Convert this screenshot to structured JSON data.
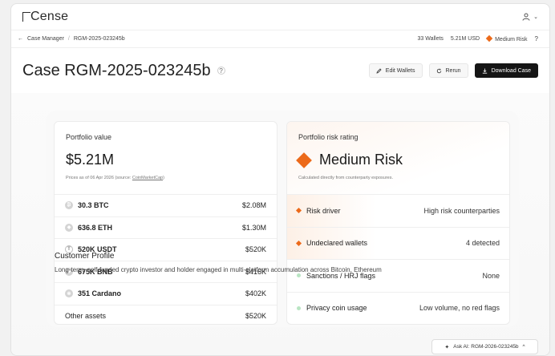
{
  "app": {
    "logo_text": "Cense"
  },
  "breadcrumb": {
    "back": "←",
    "root": "Case Manager",
    "sep": "/",
    "current": "RGM-2025-023245b"
  },
  "stats": {
    "wallets": "33 Wallets",
    "usd": "5.21M USD",
    "risk": "Medium Risk",
    "help": "?"
  },
  "page": {
    "title": "Case RGM-2025-023245b",
    "help": "?"
  },
  "actions": {
    "edit": "Edit Wallets",
    "rerun": "Rerun",
    "download": "Download Case"
  },
  "portfolio": {
    "label": "Portfolio value",
    "value": "$5.21M",
    "note_prefix": "Prices as of 06 Apr 2026 (source: ",
    "note_link": "CoinMarketCap",
    "note_suffix": ")",
    "rows": [
      {
        "name": "30.3 BTC",
        "amount": "$2.08M",
        "icon": "bitcoin-icon"
      },
      {
        "name": "636.8 ETH",
        "amount": "$1.30M",
        "icon": "ethereum-icon"
      },
      {
        "name": "520K USDT",
        "amount": "$520K",
        "icon": "tether-icon"
      },
      {
        "name": "675K BNB",
        "amount": "$416K",
        "icon": "bnb-icon"
      },
      {
        "name": "351 Cardano",
        "amount": "$402K",
        "icon": "cardano-icon"
      }
    ],
    "other": {
      "name": "Other assets",
      "amount": "$520K"
    }
  },
  "risk": {
    "label": "Portfolio risk rating",
    "value": "Medium Risk",
    "note": "Calculated directly from counterparty exposures.",
    "rows": [
      {
        "label": "Risk driver",
        "value": "High risk counterparties"
      },
      {
        "label": "Undeclared wallets",
        "value": "4 detected"
      },
      {
        "label": "Sanctions / HRJ flags",
        "value": "None"
      },
      {
        "label": "Privacy coin usage",
        "value": "Low volume, no red flags"
      }
    ]
  },
  "profile": {
    "title": "Customer Profile",
    "text": "Long-term, self-funded crypto investor and holder engaged in multi-platform accumulation across Bitcoin, Ethereum"
  },
  "ask_ai": {
    "label": "Ask AI: RGM-2026-023245b",
    "chevron": "^"
  },
  "colors": {
    "accent": "#ec6a1a",
    "ok": "#b9e5c3",
    "dark_button": "#151515"
  }
}
